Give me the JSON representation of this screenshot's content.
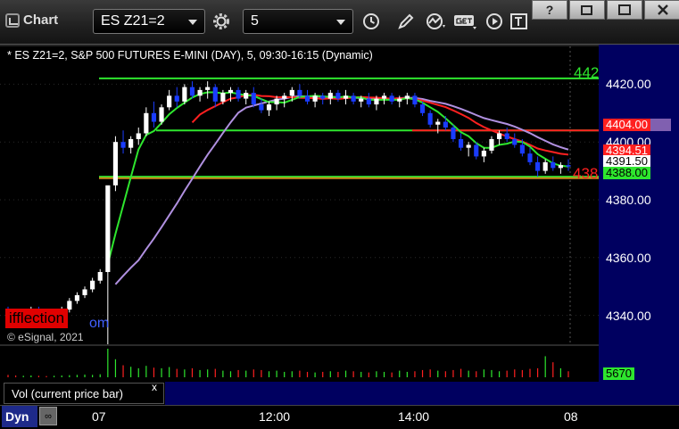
{
  "toolbar": {
    "app_title": "Chart",
    "symbol": "ES Z21=2",
    "interval": "5"
  },
  "window_buttons": [
    "?",
    "",
    "",
    ""
  ],
  "chart_header": "* ES Z21=2, S&P 500 FUTURES E-MINI (DAY), 5, 09:30-16:15 (Dynamic)",
  "watermark": "ifflection",
  "watermark_tail": "om",
  "copyright": "© eSignal, 2021",
  "volume_panel": {
    "label": "Vol (current price bar)",
    "close_glyph": "x",
    "value_label": "5670"
  },
  "bottom": {
    "dyn_label": "Dyn",
    "link_icon": "∞"
  },
  "line_value_labels": {
    "top_green": "442",
    "red_bottom": "438"
  },
  "colors": {
    "background": "#000000",
    "price_axis_bg": "#000060",
    "up_candle": "#ffffff",
    "down_candle": "#1a3cff",
    "green_line": "#2ee62e",
    "red_line": "#ff2020",
    "vwap_line": "#b090e0",
    "orange_line": "#d08a1a"
  },
  "chart_data": {
    "type": "candlestick",
    "symbol": "ES Z21=2",
    "interval": "5",
    "ylim": [
      4330,
      4430
    ],
    "y_ticks": [
      4340,
      4360,
      4380,
      4400,
      4420
    ],
    "x_tick_labels": [
      "07",
      "12:00",
      "14:00",
      "08"
    ],
    "price_labels": [
      {
        "text": "4404.00",
        "value": 4404.0,
        "bg": "#ff2020",
        "fg": "#ffffff"
      },
      {
        "text": "4394.51",
        "value": 4394.51,
        "bg": "#ff2020",
        "fg": "#ffffff"
      },
      {
        "text": "4391.50",
        "value": 4391.5,
        "bg": "#ffffff",
        "fg": "#000000"
      },
      {
        "text": "4388.00",
        "value": 4388.0,
        "bg": "#2ee62e",
        "fg": "#000000"
      }
    ],
    "hidden_label_value": 4406.0,
    "horizontal_levels": [
      {
        "value": 4422.0,
        "color": "#2ee62e"
      },
      {
        "value": 4404.0,
        "color": "#2ee62e"
      },
      {
        "value": 4404.0,
        "color": "#ff2020"
      },
      {
        "value": 4388.0,
        "color": "#2ee62e"
      },
      {
        "value": 4387.5,
        "color": "#d08a1a"
      }
    ],
    "candles": [
      [
        4342,
        4343,
        4340,
        4341
      ],
      [
        4341,
        4342,
        4339,
        4340
      ],
      [
        4340,
        4342,
        4339,
        4341
      ],
      [
        4341,
        4343,
        4340,
        4342
      ],
      [
        4342,
        4343,
        4340,
        4341
      ],
      [
        4341,
        4342,
        4339,
        4340
      ],
      [
        4340,
        4342,
        4339,
        4341
      ],
      [
        4341,
        4343,
        4340,
        4342
      ],
      [
        4342,
        4346,
        4341,
        4345
      ],
      [
        4345,
        4348,
        4344,
        4347
      ],
      [
        4347,
        4350,
        4346,
        4349
      ],
      [
        4349,
        4353,
        4348,
        4352
      ],
      [
        4352,
        4356,
        4351,
        4355
      ],
      [
        4355,
        4355,
        4330,
        4385
      ],
      [
        4385,
        4402,
        4383,
        4400
      ],
      [
        4400,
        4404,
        4396,
        4398
      ],
      [
        4398,
        4402,
        4396,
        4401
      ],
      [
        4401,
        4405,
        4399,
        4403
      ],
      [
        4403,
        4412,
        4402,
        4410
      ],
      [
        4410,
        4414,
        4405,
        4407
      ],
      [
        4407,
        4413,
        4406,
        4412
      ],
      [
        4412,
        4418,
        4411,
        4416
      ],
      [
        4416,
        4419,
        4412,
        4414
      ],
      [
        4414,
        4420,
        4413,
        4419
      ],
      [
        4419,
        4421,
        4415,
        4416
      ],
      [
        4416,
        4419,
        4414,
        4418
      ],
      [
        4418,
        4421,
        4415,
        4419
      ],
      [
        4419,
        4420,
        4412,
        4414
      ],
      [
        4414,
        4418,
        4413,
        4417
      ],
      [
        4417,
        4419,
        4414,
        4418
      ],
      [
        4418,
        4419,
        4414,
        4415
      ],
      [
        4415,
        4418,
        4413,
        4417
      ],
      [
        4417,
        4419,
        4412,
        4413
      ],
      [
        4413,
        4415,
        4410,
        4411
      ],
      [
        4411,
        4414,
        4409,
        4413
      ],
      [
        4413,
        4416,
        4411,
        4415
      ],
      [
        4415,
        4417,
        4412,
        4416
      ],
      [
        4416,
        4419,
        4414,
        4418
      ],
      [
        4418,
        4420,
        4415,
        4416
      ],
      [
        4416,
        4418,
        4413,
        4414
      ],
      [
        4414,
        4417,
        4412,
        4416
      ],
      [
        4416,
        4417,
        4413,
        4415
      ],
      [
        4415,
        4418,
        4413,
        4417
      ],
      [
        4417,
        4418,
        4414,
        4415
      ],
      [
        4415,
        4418,
        4413,
        4416
      ],
      [
        4416,
        4417,
        4413,
        4414
      ],
      [
        4414,
        4416,
        4412,
        4415
      ],
      [
        4415,
        4417,
        4412,
        4413
      ],
      [
        4413,
        4416,
        4411,
        4415
      ],
      [
        4415,
        4417,
        4413,
        4416
      ],
      [
        4416,
        4417,
        4413,
        4414
      ],
      [
        4414,
        4416,
        4412,
        4415
      ],
      [
        4415,
        4417,
        4413,
        4416
      ],
      [
        4416,
        4417,
        4412,
        4413
      ],
      [
        4413,
        4414,
        4409,
        4410
      ],
      [
        4410,
        4411,
        4405,
        4406
      ],
      [
        4406,
        4408,
        4403,
        4407
      ],
      [
        4407,
        4409,
        4404,
        4405
      ],
      [
        4405,
        4406,
        4400,
        4401
      ],
      [
        4401,
        4403,
        4397,
        4398
      ],
      [
        4398,
        4400,
        4395,
        4399
      ],
      [
        4399,
        4400,
        4394,
        4395
      ],
      [
        4395,
        4398,
        4393,
        4397
      ],
      [
        4397,
        4402,
        4396,
        4401
      ],
      [
        4401,
        4404,
        4399,
        4403
      ],
      [
        4403,
        4405,
        4400,
        4401
      ],
      [
        4401,
        4403,
        4398,
        4399
      ],
      [
        4399,
        4401,
        4395,
        4396
      ],
      [
        4396,
        4398,
        4392,
        4393
      ],
      [
        4393,
        4395,
        4388,
        4390
      ],
      [
        4390,
        4394,
        4389,
        4393
      ],
      [
        4393,
        4395,
        4390,
        4391
      ],
      [
        4391,
        4393,
        4389,
        4392
      ],
      [
        4392,
        4394,
        4390,
        4391.5
      ]
    ],
    "volume": [
      8,
      6,
      5,
      6,
      5,
      4,
      5,
      6,
      7,
      8,
      9,
      8,
      10,
      95,
      60,
      40,
      35,
      30,
      38,
      32,
      30,
      34,
      28,
      26,
      30,
      24,
      26,
      28,
      22,
      20,
      24,
      22,
      26,
      24,
      20,
      22,
      18,
      20,
      22,
      18,
      16,
      18,
      20,
      18,
      22,
      20,
      18,
      16,
      20,
      18,
      16,
      22,
      18,
      20,
      24,
      26,
      22,
      20,
      24,
      28,
      22,
      20,
      26,
      24,
      20,
      22,
      26,
      24,
      28,
      30,
      70,
      50,
      30,
      20
    ]
  }
}
